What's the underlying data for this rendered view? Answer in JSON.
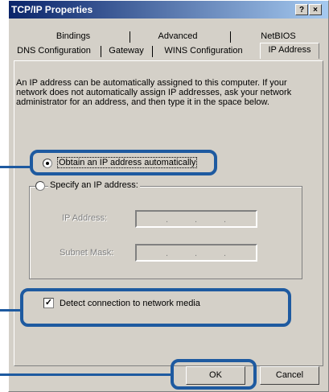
{
  "window": {
    "title": "TCP/IP Properties",
    "help_button": "?",
    "close_button": "×"
  },
  "tabs": {
    "row_top": [
      "Bindings",
      "Advanced",
      "NetBIOS"
    ],
    "row_bottom": [
      "DNS Configuration",
      "Gateway",
      "WINS Configuration",
      "IP Address"
    ],
    "active": "IP Address"
  },
  "intro_text": "An IP address can be automatically assigned to this computer. If your network does not automatically assign IP addresses, ask your network administrator for an address, and then type it in the space below.",
  "options": {
    "obtain_auto_label": "Obtain an IP address automatically",
    "obtain_auto_selected": true,
    "specify_label": "Specify an IP address:",
    "specify_selected": false
  },
  "fields": {
    "ip_address_label": "IP Address:",
    "subnet_mask_label": "Subnet Mask:",
    "ip_address_value": "",
    "subnet_mask_value": ""
  },
  "detect_media": {
    "label": "Detect connection to network media",
    "checked": true,
    "check_glyph": "✓"
  },
  "buttons": {
    "ok": "OK",
    "cancel": "Cancel"
  },
  "colors": {
    "callout": "#1e5aa0",
    "dialog_face": "#d4d0c8",
    "titlebar_start": "#0a246a",
    "titlebar_end": "#a6caf0"
  }
}
